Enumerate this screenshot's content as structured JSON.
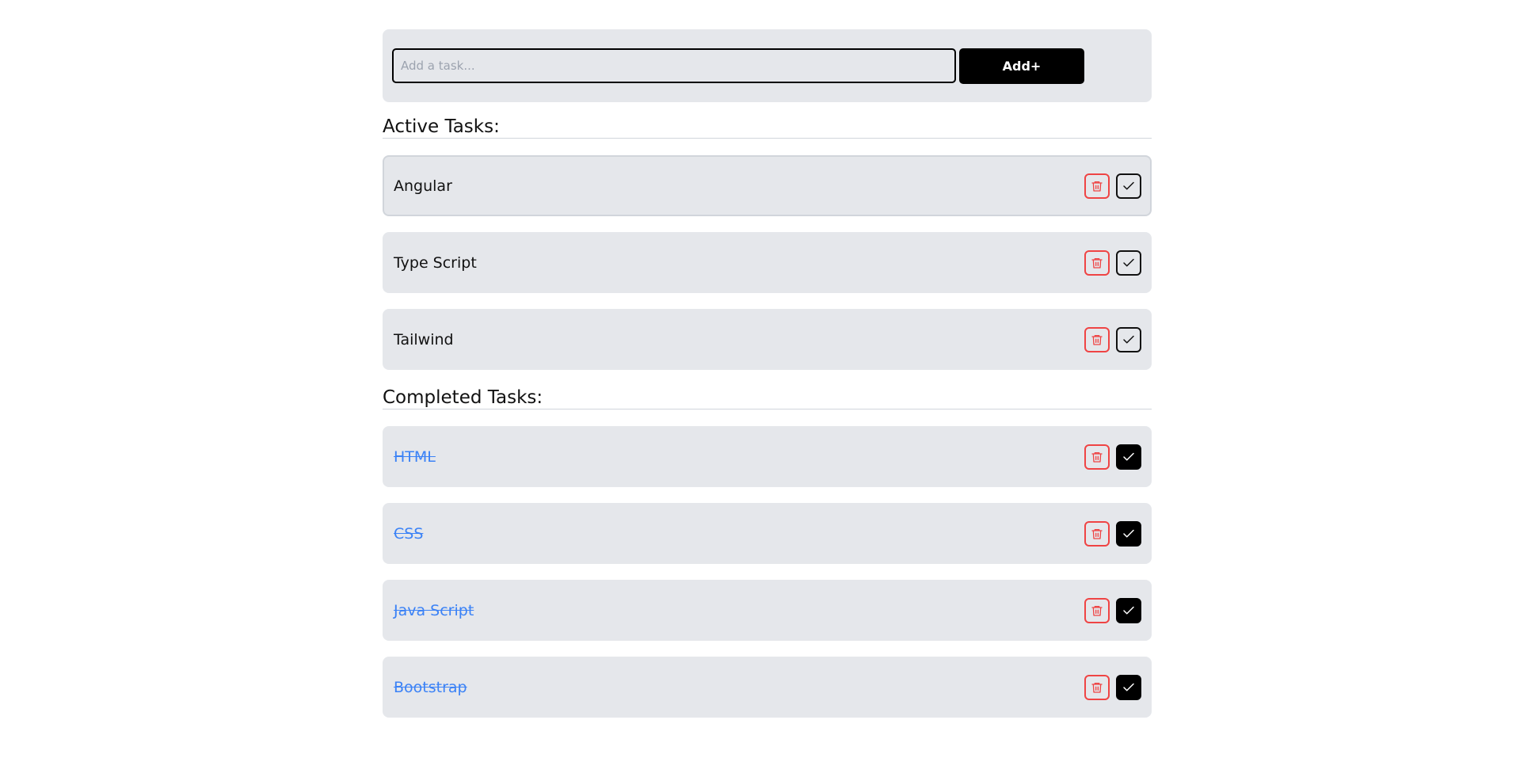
{
  "add_form": {
    "placeholder": "Add a task...",
    "value": "",
    "button_label": "Add+"
  },
  "active": {
    "heading": "Active Tasks:",
    "items": [
      {
        "label": "Angular"
      },
      {
        "label": "Type Script"
      },
      {
        "label": "Tailwind"
      }
    ]
  },
  "completed": {
    "heading": "Completed Tasks:",
    "items": [
      {
        "label": "HTML"
      },
      {
        "label": "CSS"
      },
      {
        "label": "Java Script"
      },
      {
        "label": "Bootstrap"
      }
    ]
  },
  "icons": {
    "delete": "trash-icon",
    "complete": "check-icon"
  },
  "colors": {
    "panel_bg": "#e5e7eb",
    "delete_accent": "#ef4444",
    "completed_text": "#3b82f6",
    "primary_button": "#000000"
  }
}
